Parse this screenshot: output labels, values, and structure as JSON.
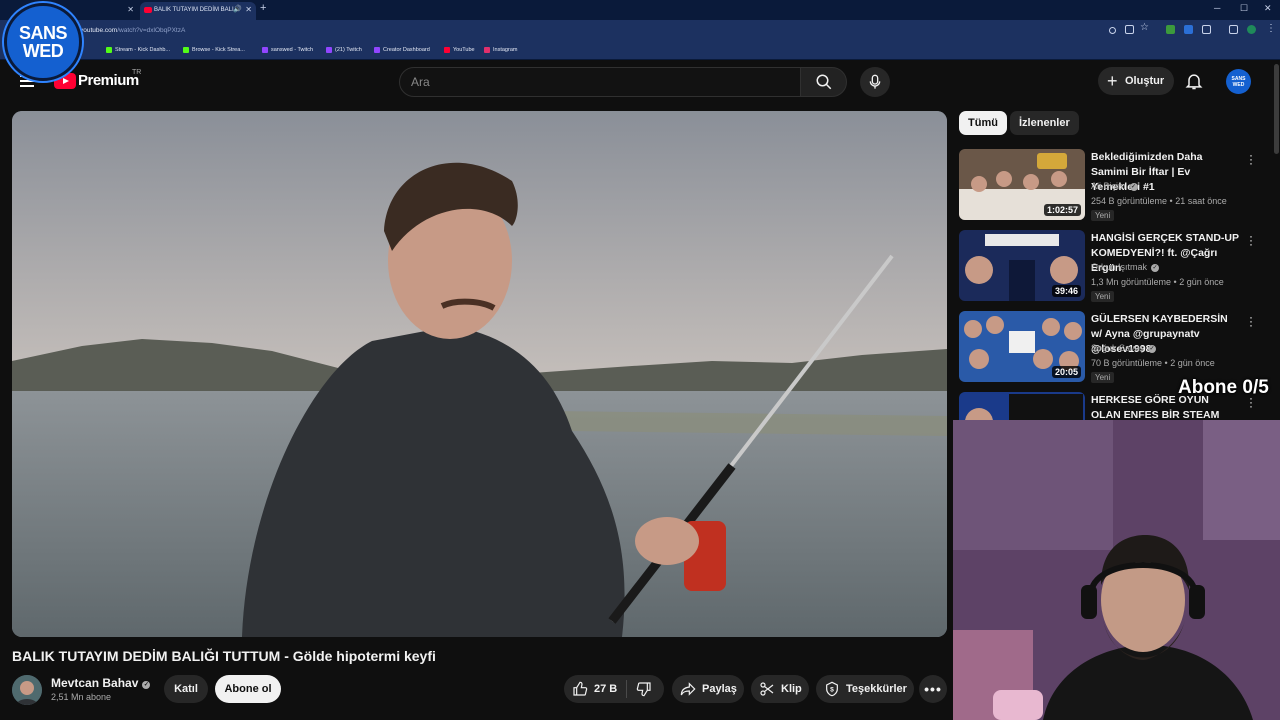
{
  "browser": {
    "tabs": [
      {
        "title": ""
      },
      {
        "title": "BALIK TUTAYIM DEDİM BALI"
      }
    ],
    "url_host": "youtube.com",
    "url_path": "/watch?v=dxlObqPXtzA",
    "bookmarks": [
      {
        "label": "Stream - Kick Dashb...",
        "color": "#53fc18"
      },
      {
        "label": "Browse - Kick Strea...",
        "color": "#53fc18"
      },
      {
        "label": "sanswed - Twitch",
        "color": "#9146ff"
      },
      {
        "label": "(21) Twitch",
        "color": "#9146ff"
      },
      {
        "label": "Creator Dashboard",
        "color": "#9146ff"
      },
      {
        "label": "YouTube",
        "color": "#ff0033"
      },
      {
        "label": "Instagram",
        "color": "#e1306c"
      }
    ]
  },
  "overlay": {
    "logo_line1": "SANS",
    "logo_line2": "WED",
    "subscriber_goal": "Abone 0/5"
  },
  "masthead": {
    "brand": "Premium",
    "country": "TR",
    "search_placeholder": "Ara",
    "create_label": "Oluştur",
    "avatar_text": "SANS WED"
  },
  "video": {
    "title": "BALIK TUTAYIM DEDİM BALIĞI TUTTUM - Gölde hipotermi keyfi",
    "channel": "Mevtcan Bahav",
    "subscribers": "2,51 Mn abone",
    "join_label": "Katıl",
    "subscribe_label": "Abone ol",
    "likes": "27 B",
    "share_label": "Paylaş",
    "clip_label": "Klip",
    "thanks_label": "Teşekkürler",
    "more_label": "•••"
  },
  "sidebar": {
    "chips": [
      "Tümü",
      "İzlenenler"
    ],
    "recommendations": [
      {
        "title": "Beklediğimizden Daha Samimi Bir İftar | Ev Yemekleri #1",
        "channel": "Ali Biçim",
        "meta": "254 B görüntüleme • 21 saat önce",
        "badge": "Yeni",
        "duration": "1:02:57"
      },
      {
        "title": "HANGİSİ GERÇEK STAND-UP KOMEDYENİ?! ft. @Çağrı Ergün",
        "channel": "Orkun Işıtmak",
        "meta": "1,3 Mn görüntüleme • 2 gün önce",
        "badge": "Yeni",
        "duration": "39:46"
      },
      {
        "title": "GÜLERSEN KAYBEDERSİN w/ Ayna @grupaynatv @losev1998",
        "channel": "Soğuk Savaş",
        "meta": "70 B görüntüleme • 2 gün önce",
        "badge": "Yeni",
        "duration": "20:05"
      },
      {
        "title": "HERKESE GÖRE OYUN OLAN ENFES BİR STEAM OYUN ...",
        "channel": "",
        "meta": "",
        "badge": "",
        "duration": ""
      }
    ]
  }
}
